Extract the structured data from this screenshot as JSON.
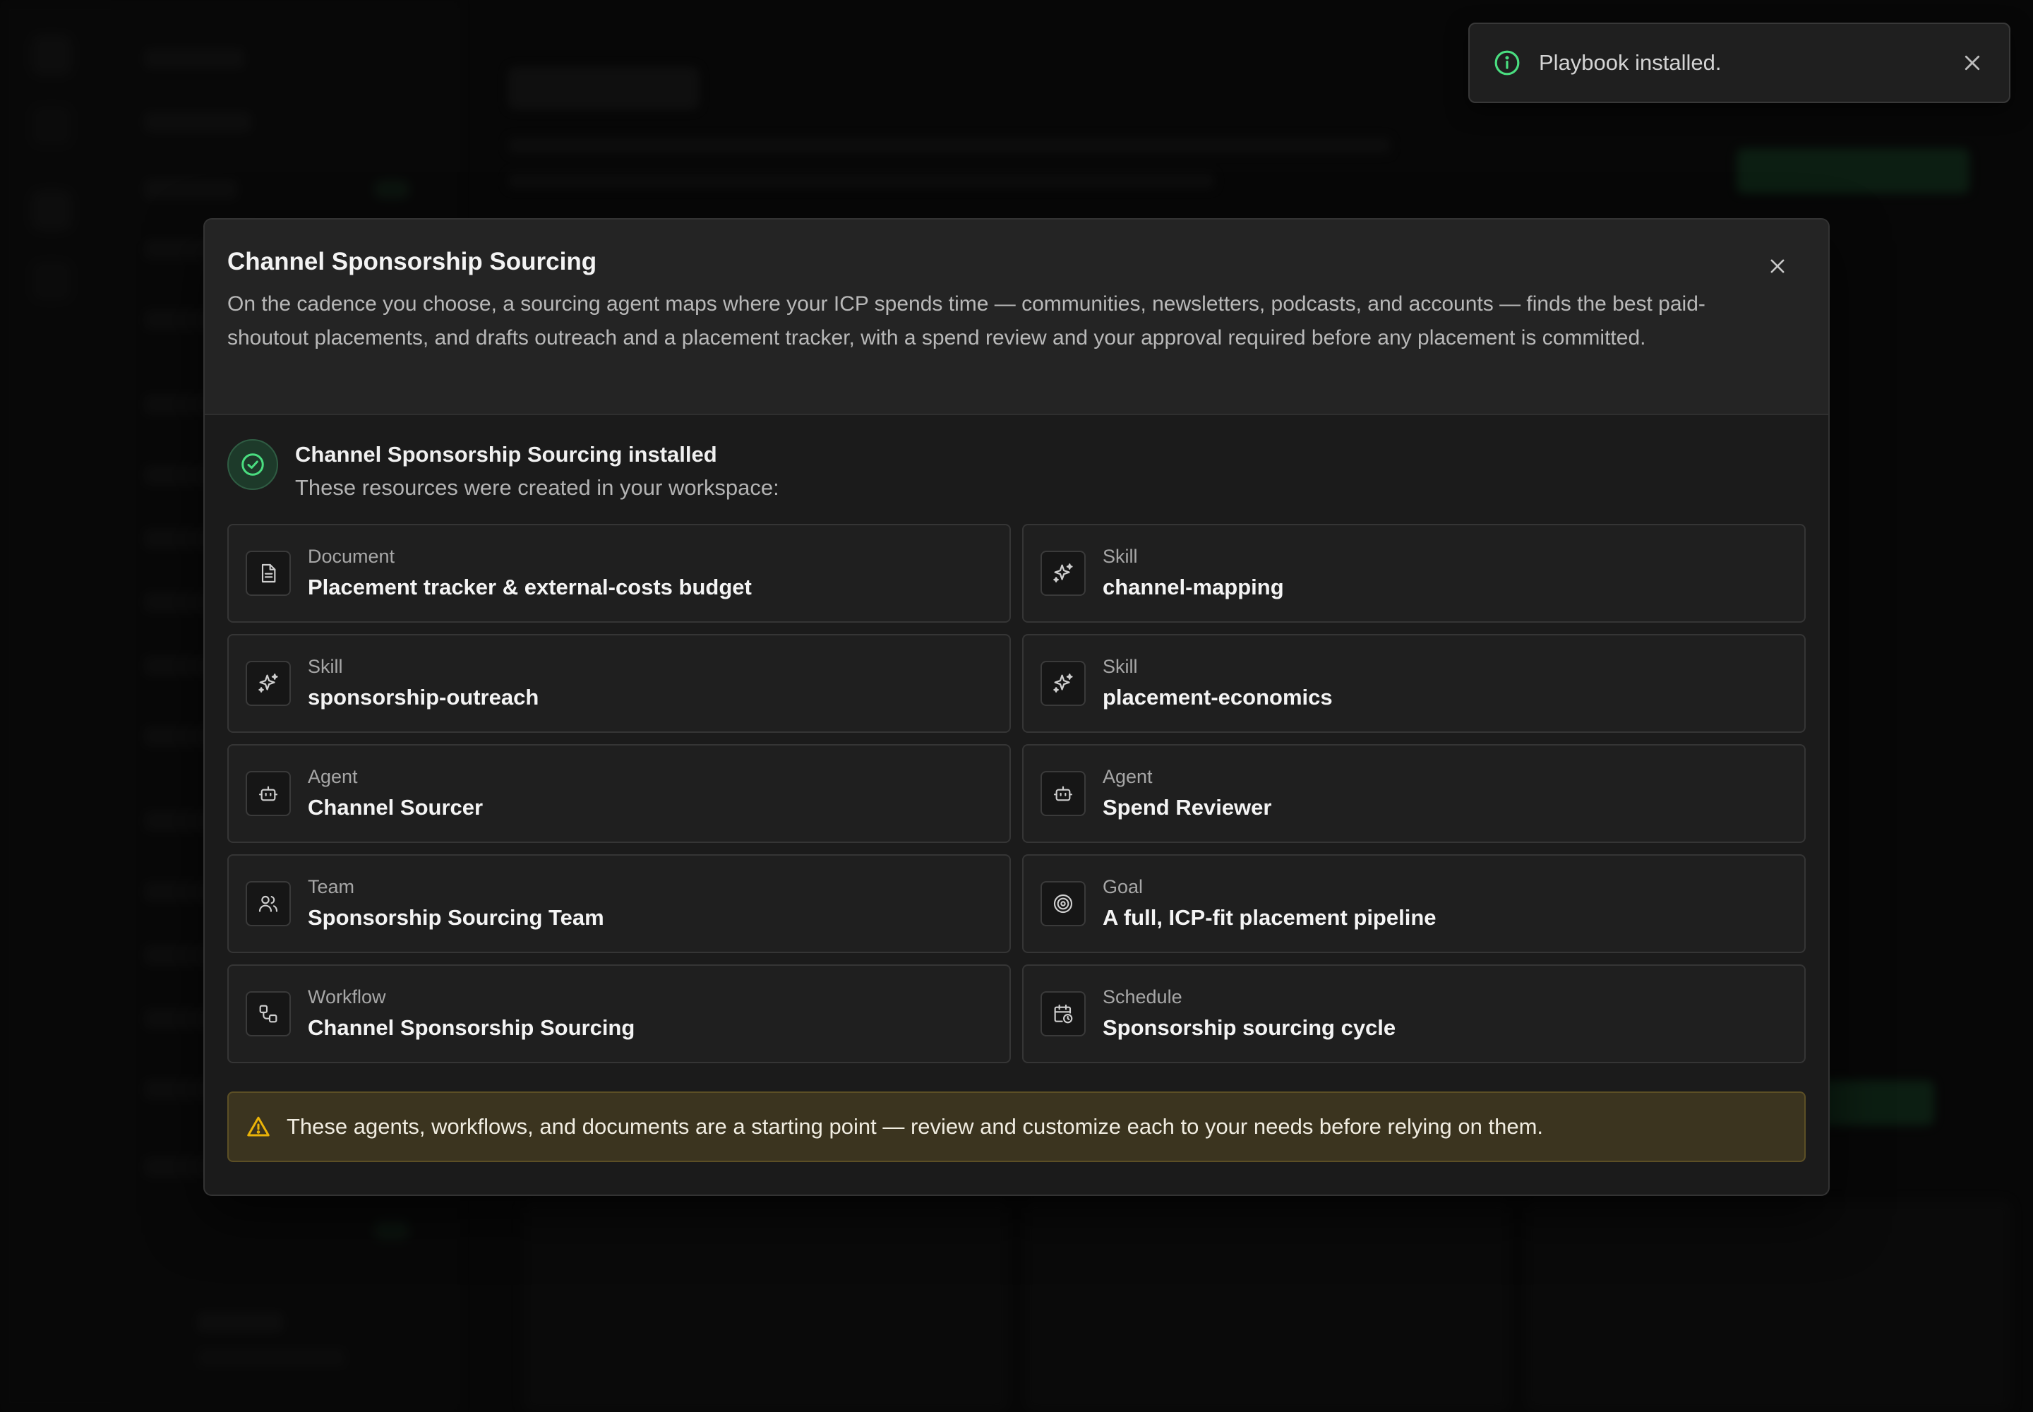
{
  "toast": {
    "message": "Playbook installed.",
    "icon": "info-icon",
    "close_icon": "close-icon",
    "accent": "#4ade80"
  },
  "modal": {
    "title": "Channel Sponsorship Sourcing",
    "description": "On the cadence you choose, a sourcing agent maps where your ICP spends time — communities, newsletters, podcasts, and accounts — finds the best paid-shoutout placements, and drafts outreach and a placement tracker, with a spend review and your approval required before any placement is committed.",
    "installed": {
      "title": "Channel Sponsorship Sourcing installed",
      "subtitle": "These resources were created in your workspace:",
      "icon": "check-circle-icon",
      "color": "#4ade80"
    },
    "resources": [
      {
        "type": "Document",
        "name": "Placement tracker & external-costs budget",
        "icon": "document-icon"
      },
      {
        "type": "Skill",
        "name": "channel-mapping",
        "icon": "sparkle-icon"
      },
      {
        "type": "Skill",
        "name": "sponsorship-outreach",
        "icon": "sparkle-icon"
      },
      {
        "type": "Skill",
        "name": "placement-economics",
        "icon": "sparkle-icon"
      },
      {
        "type": "Agent",
        "name": "Channel Sourcer",
        "icon": "bot-icon"
      },
      {
        "type": "Agent",
        "name": "Spend Reviewer",
        "icon": "bot-icon"
      },
      {
        "type": "Team",
        "name": "Sponsorship Sourcing Team",
        "icon": "users-icon"
      },
      {
        "type": "Goal",
        "name": "A full, ICP-fit placement pipeline",
        "icon": "target-icon"
      },
      {
        "type": "Workflow",
        "name": "Channel Sponsorship Sourcing",
        "icon": "workflow-icon"
      },
      {
        "type": "Schedule",
        "name": "Sponsorship sourcing cycle",
        "icon": "calendar-clock-icon"
      }
    ],
    "warning": {
      "text": "These agents, workflows, and documents are a starting point — review and customize each to your needs before relying on them.",
      "icon": "warning-triangle-icon",
      "color": "#eab308"
    }
  }
}
